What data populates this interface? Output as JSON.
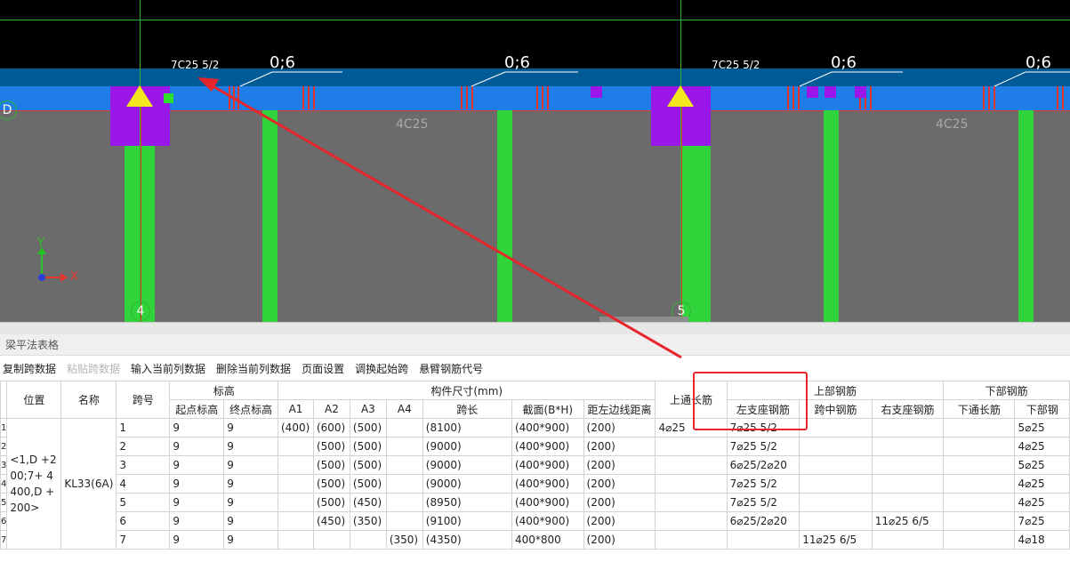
{
  "viewport": {
    "rebar_labels": [
      "7C25 5/2",
      "7C25 5/2"
    ],
    "span_counts": [
      "0;6",
      "0;6",
      "0;6",
      "0;6"
    ],
    "slab_labels": [
      "4C25",
      "4C25"
    ],
    "grid_bubbles": [
      "D",
      "4",
      "5"
    ],
    "axis": {
      "y": "Y",
      "x": "X"
    },
    "colors": {
      "background": "#000000",
      "slab": "#6b6b6b",
      "beam": "#1e7de6",
      "column": "#30d43a",
      "column_top": "#9b16e8",
      "annotation": "#e6262c"
    }
  },
  "panel": {
    "title": "梁平法表格",
    "toolbar": [
      {
        "label": "复制跨数据",
        "enabled": true
      },
      {
        "label": "粘贴跨数据",
        "enabled": false
      },
      {
        "label": "输入当前列数据",
        "enabled": true
      },
      {
        "label": "删除当前列数据",
        "enabled": true
      },
      {
        "label": "页面设置",
        "enabled": true
      },
      {
        "label": "调换起始跨",
        "enabled": true
      },
      {
        "label": "悬臂钢筋代号",
        "enabled": true
      }
    ]
  },
  "table": {
    "headers": {
      "position": "位置",
      "name": "名称",
      "span_no": "跨号",
      "elevation": "标高",
      "start_elev": "起点标高",
      "end_elev": "终点标高",
      "dims": "构件尺寸(mm)",
      "a1": "A1",
      "a2": "A2",
      "a3": "A3",
      "a4": "A4",
      "span_len": "跨长",
      "section": "截面(B*H)",
      "left_dist": "距左边线距离",
      "top_through": "上通长筋",
      "top_rebar": "上部钢筋",
      "left_support": "左支座钢筋",
      "mid_span": "跨中钢筋",
      "right_support": "右支座钢筋",
      "bottom_rebar": "下部钢筋",
      "bottom_through": "下通长筋",
      "bottom_part": "下部钢"
    },
    "position_value": "<1,D +200;7+ 4400,D +200>",
    "name_value": "KL33(6A)",
    "row_index": [
      "1",
      "2",
      "3",
      "4",
      "5",
      "6",
      "7"
    ],
    "rows": [
      {
        "span": "1",
        "start": "9",
        "end": "9",
        "a1": "(400)",
        "a2": "(600)",
        "a3": "(500)",
        "a4": "",
        "len": "(8100)",
        "sec": "(400*900)",
        "dist": "(200)",
        "top_through": "4⌀25",
        "left": "7⌀25 5/2",
        "mid": "",
        "right": "",
        "bot_through": "",
        "bot": "5⌀25"
      },
      {
        "span": "2",
        "start": "9",
        "end": "9",
        "a1": "",
        "a2": "(500)",
        "a3": "(500)",
        "a4": "",
        "len": "(9000)",
        "sec": "(400*900)",
        "dist": "(200)",
        "top_through": "",
        "left": "7⌀25 5/2",
        "mid": "",
        "right": "",
        "bot_through": "",
        "bot": "4⌀25"
      },
      {
        "span": "3",
        "start": "9",
        "end": "9",
        "a1": "",
        "a2": "(500)",
        "a3": "(500)",
        "a4": "",
        "len": "(9000)",
        "sec": "(400*900)",
        "dist": "(200)",
        "top_through": "",
        "left": "6⌀25/2⌀20",
        "mid": "",
        "right": "",
        "bot_through": "",
        "bot": "5⌀25"
      },
      {
        "span": "4",
        "start": "9",
        "end": "9",
        "a1": "",
        "a2": "(500)",
        "a3": "(500)",
        "a4": "",
        "len": "(9000)",
        "sec": "(400*900)",
        "dist": "(200)",
        "top_through": "",
        "left": "7⌀25 5/2",
        "mid": "",
        "right": "",
        "bot_through": "",
        "bot": "4⌀25"
      },
      {
        "span": "5",
        "start": "9",
        "end": "9",
        "a1": "",
        "a2": "(500)",
        "a3": "(450)",
        "a4": "",
        "len": "(8950)",
        "sec": "(400*900)",
        "dist": "(200)",
        "top_through": "",
        "left": "7⌀25 5/2",
        "mid": "",
        "right": "",
        "bot_through": "",
        "bot": "4⌀25"
      },
      {
        "span": "6",
        "start": "9",
        "end": "9",
        "a1": "",
        "a2": "(450)",
        "a3": "(350)",
        "a4": "",
        "len": "(9100)",
        "sec": "(400*900)",
        "dist": "(200)",
        "top_through": "",
        "left": "6⌀25/2⌀20",
        "mid": "",
        "right": "11⌀25 6/5",
        "bot_through": "",
        "bot": "7⌀25"
      },
      {
        "span": "7",
        "start": "9",
        "end": "9",
        "a1": "",
        "a2": "",
        "a3": "",
        "a4": "(350)",
        "len": "(4350)",
        "sec": "400*800",
        "dist": "(200)",
        "top_through": "",
        "left": "",
        "mid": "11⌀25 6/5",
        "right": "",
        "bot_through": "",
        "bot": "4⌀18"
      }
    ]
  }
}
